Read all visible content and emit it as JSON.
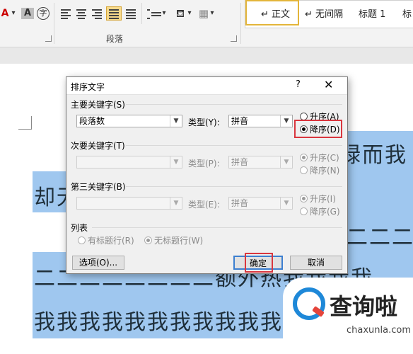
{
  "ribbon": {
    "font_color_glyph": "A",
    "char_shading_glyph": "A",
    "enclose_glyph": "字",
    "group_label": "段落",
    "styles": [
      "↵ 正文",
      "↵ 无间隔",
      "标题 1",
      "标"
    ],
    "accent_color": "#e3b53a"
  },
  "document": {
    "lines": [
      "绿而我",
      "却无",
      "二二二",
      "二二二二二二二二额外热我我我我",
      "我我我我我我我我我我我"
    ]
  },
  "dialog": {
    "title": "排序文字",
    "help": "?",
    "close": "✕",
    "primary": {
      "label": "主要关键字(S)",
      "field_value": "段落数",
      "type_label": "类型(Y):",
      "type_value": "拼音",
      "asc": "升序(A)",
      "desc": "降序(D)"
    },
    "secondary": {
      "label": "次要关键字(T)",
      "field_value": "",
      "type_label": "类型(P):",
      "type_value": "拼音",
      "asc": "升序(C)",
      "desc": "降序(N)"
    },
    "tertiary": {
      "label": "第三关键字(B)",
      "field_value": "",
      "type_label": "类型(E):",
      "type_value": "拼音",
      "asc": "升序(I)",
      "desc": "降序(G)"
    },
    "list": {
      "label": "列表",
      "has_header": "有标题行(R)",
      "no_header": "无标题行(W)"
    },
    "options_button": "选项(O)...",
    "ok_button": "确定",
    "cancel_button": "取消",
    "highlight_color": "#d9363e"
  },
  "watermark": {
    "title": "查询啦",
    "url": "chaxunla.com",
    "logo_color": "#1e88d8"
  }
}
